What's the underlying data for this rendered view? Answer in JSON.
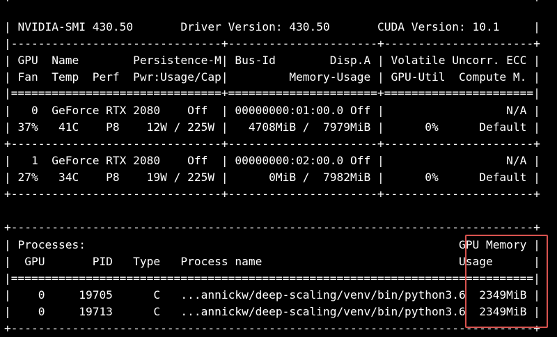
{
  "terminal": {
    "lines": [
      "+-----------------------------------------------------------------------------+",
      "| NVIDIA-SMI 430.50       Driver Version: 430.50       CUDA Version: 10.1     |",
      "|-------------------------------+----------------------+----------------------+",
      "| GPU  Name        Persistence-M| Bus-Id        Disp.A | Volatile Uncorr. ECC |",
      "| Fan  Temp  Perf  Pwr:Usage/Cap|         Memory-Usage | GPU-Util  Compute M. |",
      "|===============================+======================+======================|",
      "|   0  GeForce RTX 2080    Off  | 00000000:01:00.0 Off |                  N/A |",
      "| 37%   41C    P8    12W / 225W |   4708MiB /  7979MiB |      0%      Default |",
      "+-------------------------------+----------------------+----------------------+",
      "|   1  GeForce RTX 2080    Off  | 00000000:02:00.0 Off |                  N/A |",
      "| 27%   34C    P8    19W / 225W |      0MiB /  7982MiB |      0%      Default |",
      "+-------------------------------+----------------------+----------------------+",
      "",
      "+-----------------------------------------------------------------------------+",
      "| Processes:                                                       GPU Memory |",
      "|  GPU       PID   Type   Process name                             Usage      |",
      "|=============================================================================|",
      "|    0     19705      C   ...annickw/deep-scaling/venv/bin/python3.6  2349MiB |",
      "|    0     19713      C   ...annickw/deep-scaling/venv/bin/python3.6  2349MiB |",
      "+-----------------------------------------------------------------------------+"
    ]
  },
  "highlight": {
    "color": "#d9534f"
  }
}
